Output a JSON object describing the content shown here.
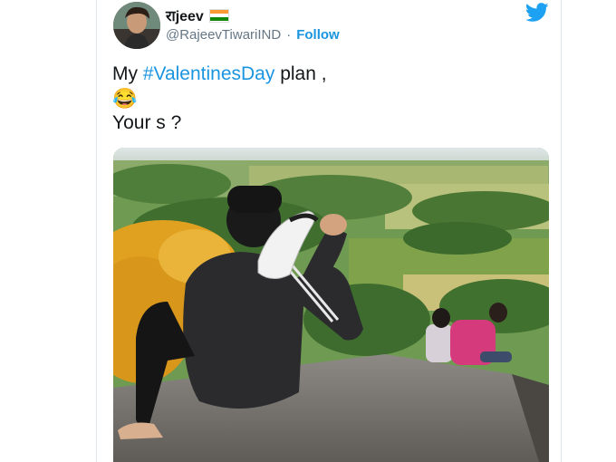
{
  "header": {
    "display_name": "राjeev",
    "handle": "@RajeevTiwariIND",
    "separator": "·",
    "follow_label": "Follow"
  },
  "tweet": {
    "line1_prefix": "My ",
    "hashtag": "#ValentinesDay",
    "line1_suffix": " plan ,",
    "emoji": "😂",
    "line3": "Your s ?"
  },
  "colors": {
    "link": "#1b95e0",
    "text": "#14171a",
    "muted": "#657786"
  },
  "icons": {
    "brand": "twitter-bird-icon",
    "flag": "india-flag-icon"
  }
}
